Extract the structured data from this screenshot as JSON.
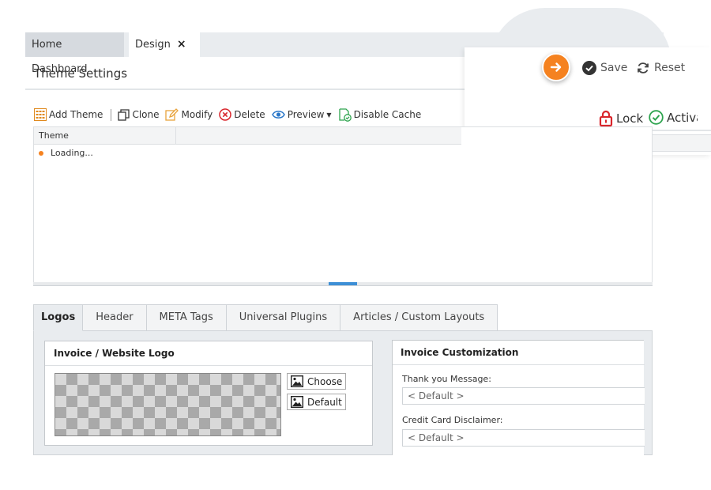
{
  "tabs": [
    {
      "label": "Home Dashboard"
    },
    {
      "label": "Design",
      "close": "×"
    }
  ],
  "header": {
    "title": "Theme Settings",
    "save_label": "Save",
    "reset_label": "Reset",
    "lock_label": "Lock",
    "activate_label": "Activa"
  },
  "toolbar": {
    "add_theme": "Add Theme",
    "clone": "Clone",
    "modify": "Modify",
    "delete": "Delete",
    "preview": "Preview",
    "disable_cache": "Disable Cache"
  },
  "grid": {
    "column_header": "Theme",
    "loading_text": "Loading..."
  },
  "bottom_tabs": [
    "Logos",
    "Header",
    "META Tags",
    "Universal Plugins",
    "Articles / Custom Layouts"
  ],
  "logo_section": {
    "title": "Invoice / Website Logo",
    "choose_label": "Choose",
    "default_label": "Default"
  },
  "invoice_section": {
    "title": "Invoice Customization",
    "thank_you_label": "Thank you Message:",
    "thank_you_value": "< Default >",
    "cc_label": "Credit Card Disclaimer:",
    "cc_value": "< Default >"
  },
  "colors": {
    "accent_orange": "#f58220",
    "splitter_blue": "#3d8fd6",
    "lock_red": "#d9262c",
    "activate_green": "#2ea44f"
  }
}
